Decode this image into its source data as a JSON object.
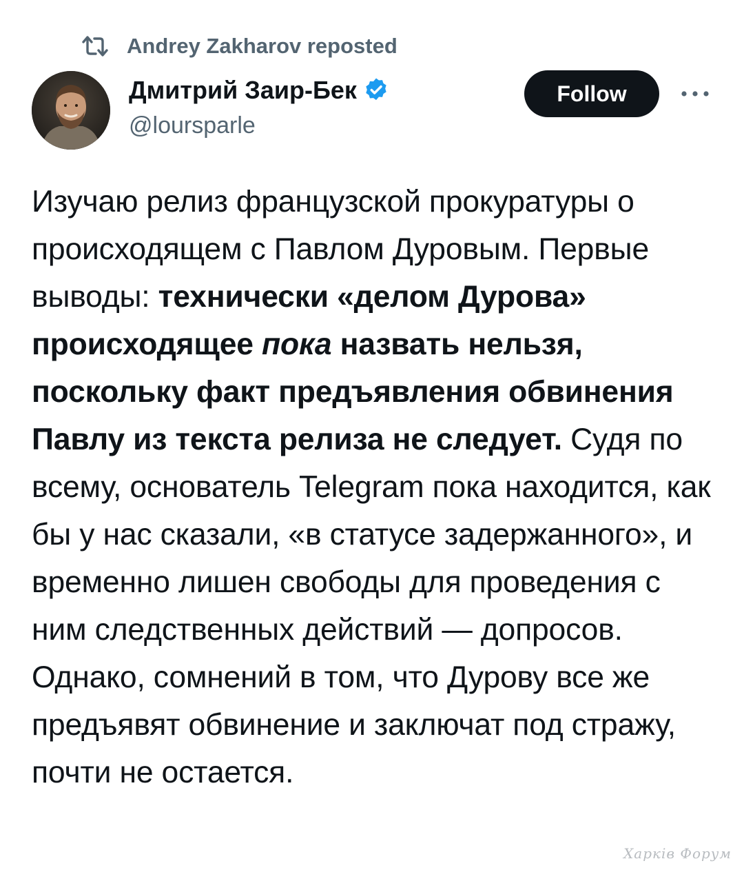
{
  "repost": {
    "text": "Andrey Zakharov reposted",
    "icon": "repost-icon"
  },
  "author": {
    "display_name": "Дмитрий Заир-Бек",
    "handle": "@loursparle",
    "verified": true,
    "verified_color": "#1d9bf0"
  },
  "actions": {
    "follow_label": "Follow",
    "more_icon": "more-dots-icon"
  },
  "tweet": {
    "segments": [
      {
        "text": "Изучаю релиз французской прокуратуры о происходящем с Павлом Дуровым. Первые выводы: ",
        "style": "normal"
      },
      {
        "text": "технически «делом Дурова» происходящее ",
        "style": "bold"
      },
      {
        "text": "пока",
        "style": "bold-italic"
      },
      {
        "text": " назвать нельзя, поскольку факт предъявления обвинения Павлу из текста релиза не следует.",
        "style": "bold"
      },
      {
        "text": " Судя по всему, основатель Telegram пока находится, как бы у нас сказали, «в статусе задержанного», и временно лишен свободы для проведения с ним следственных действий — допросов. Однако, сомнений в том, что Дурову все же предъявят обвинение и заключат под стражу, почти не остается.",
        "style": "normal"
      }
    ]
  },
  "watermark": "Харків Форум",
  "colors": {
    "text_primary": "#0f1419",
    "text_secondary": "#536471",
    "button_bg": "#0f1419",
    "button_text": "#ffffff",
    "verified": "#1d9bf0"
  }
}
